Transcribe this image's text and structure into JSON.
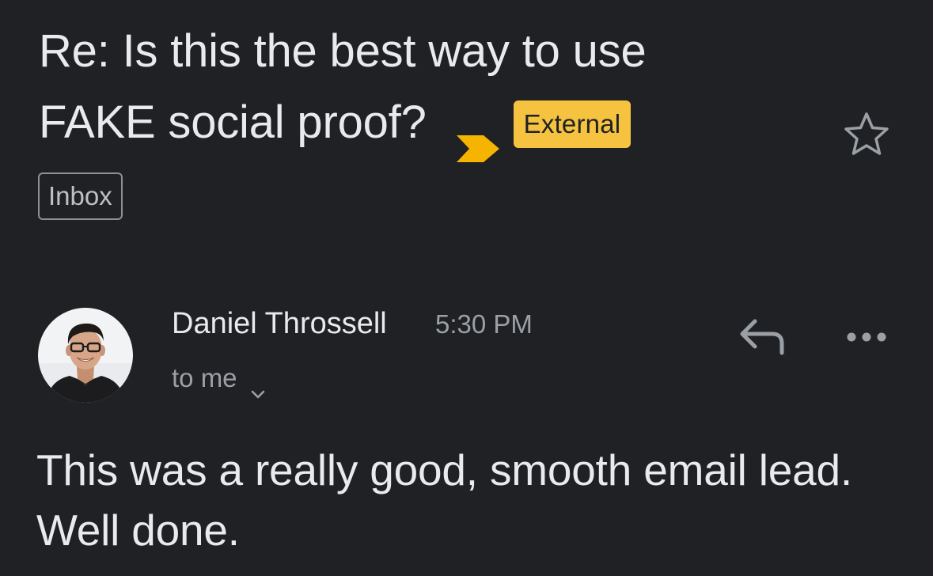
{
  "subject": {
    "line1": "Re: Is this the best way to use",
    "line2": "FAKE social proof?",
    "importance_icon": "importance-marker-icon",
    "external_badge": "External"
  },
  "labels": {
    "inbox": "Inbox"
  },
  "sender": {
    "name": "Daniel Throssell",
    "time": "5:30 PM",
    "recipients": "to me",
    "avatar_icon": "avatar"
  },
  "actions": {
    "star_icon": "star-icon",
    "reply_icon": "reply-icon",
    "more_icon": "more-options-icon",
    "expand_icon": "chevron-down-icon"
  },
  "message": {
    "body": "This was a really good, smooth email lead. Well done."
  },
  "colors": {
    "background": "#202124",
    "text_primary": "#e8eaed",
    "text_secondary": "#9aa0a6",
    "external_badge": "#f6c340",
    "importance_marker": "#f4b400"
  }
}
